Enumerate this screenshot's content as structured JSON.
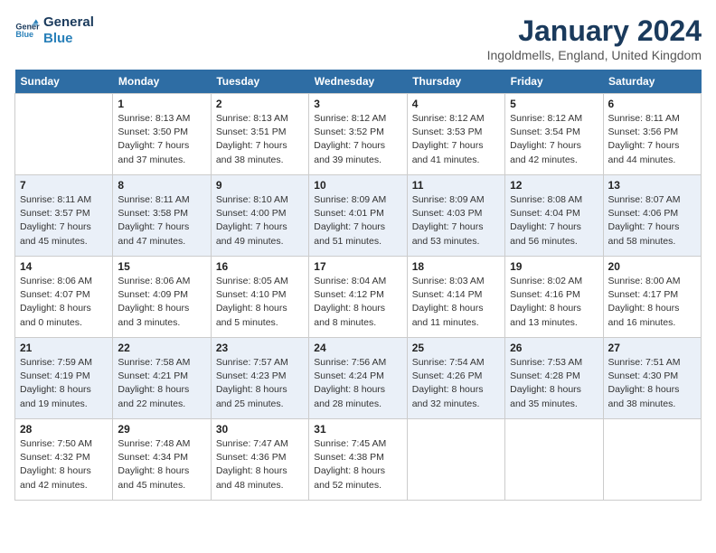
{
  "header": {
    "logo_line1": "General",
    "logo_line2": "Blue",
    "month_title": "January 2024",
    "location": "Ingoldmells, England, United Kingdom"
  },
  "days_of_week": [
    "Sunday",
    "Monday",
    "Tuesday",
    "Wednesday",
    "Thursday",
    "Friday",
    "Saturday"
  ],
  "weeks": [
    [
      {
        "day": "",
        "sunrise": "",
        "sunset": "",
        "daylight": ""
      },
      {
        "day": "1",
        "sunrise": "Sunrise: 8:13 AM",
        "sunset": "Sunset: 3:50 PM",
        "daylight": "Daylight: 7 hours and 37 minutes."
      },
      {
        "day": "2",
        "sunrise": "Sunrise: 8:13 AM",
        "sunset": "Sunset: 3:51 PM",
        "daylight": "Daylight: 7 hours and 38 minutes."
      },
      {
        "day": "3",
        "sunrise": "Sunrise: 8:12 AM",
        "sunset": "Sunset: 3:52 PM",
        "daylight": "Daylight: 7 hours and 39 minutes."
      },
      {
        "day": "4",
        "sunrise": "Sunrise: 8:12 AM",
        "sunset": "Sunset: 3:53 PM",
        "daylight": "Daylight: 7 hours and 41 minutes."
      },
      {
        "day": "5",
        "sunrise": "Sunrise: 8:12 AM",
        "sunset": "Sunset: 3:54 PM",
        "daylight": "Daylight: 7 hours and 42 minutes."
      },
      {
        "day": "6",
        "sunrise": "Sunrise: 8:11 AM",
        "sunset": "Sunset: 3:56 PM",
        "daylight": "Daylight: 7 hours and 44 minutes."
      }
    ],
    [
      {
        "day": "7",
        "sunrise": "Sunrise: 8:11 AM",
        "sunset": "Sunset: 3:57 PM",
        "daylight": "Daylight: 7 hours and 45 minutes."
      },
      {
        "day": "8",
        "sunrise": "Sunrise: 8:11 AM",
        "sunset": "Sunset: 3:58 PM",
        "daylight": "Daylight: 7 hours and 47 minutes."
      },
      {
        "day": "9",
        "sunrise": "Sunrise: 8:10 AM",
        "sunset": "Sunset: 4:00 PM",
        "daylight": "Daylight: 7 hours and 49 minutes."
      },
      {
        "day": "10",
        "sunrise": "Sunrise: 8:09 AM",
        "sunset": "Sunset: 4:01 PM",
        "daylight": "Daylight: 7 hours and 51 minutes."
      },
      {
        "day": "11",
        "sunrise": "Sunrise: 8:09 AM",
        "sunset": "Sunset: 4:03 PM",
        "daylight": "Daylight: 7 hours and 53 minutes."
      },
      {
        "day": "12",
        "sunrise": "Sunrise: 8:08 AM",
        "sunset": "Sunset: 4:04 PM",
        "daylight": "Daylight: 7 hours and 56 minutes."
      },
      {
        "day": "13",
        "sunrise": "Sunrise: 8:07 AM",
        "sunset": "Sunset: 4:06 PM",
        "daylight": "Daylight: 7 hours and 58 minutes."
      }
    ],
    [
      {
        "day": "14",
        "sunrise": "Sunrise: 8:06 AM",
        "sunset": "Sunset: 4:07 PM",
        "daylight": "Daylight: 8 hours and 0 minutes."
      },
      {
        "day": "15",
        "sunrise": "Sunrise: 8:06 AM",
        "sunset": "Sunset: 4:09 PM",
        "daylight": "Daylight: 8 hours and 3 minutes."
      },
      {
        "day": "16",
        "sunrise": "Sunrise: 8:05 AM",
        "sunset": "Sunset: 4:10 PM",
        "daylight": "Daylight: 8 hours and 5 minutes."
      },
      {
        "day": "17",
        "sunrise": "Sunrise: 8:04 AM",
        "sunset": "Sunset: 4:12 PM",
        "daylight": "Daylight: 8 hours and 8 minutes."
      },
      {
        "day": "18",
        "sunrise": "Sunrise: 8:03 AM",
        "sunset": "Sunset: 4:14 PM",
        "daylight": "Daylight: 8 hours and 11 minutes."
      },
      {
        "day": "19",
        "sunrise": "Sunrise: 8:02 AM",
        "sunset": "Sunset: 4:16 PM",
        "daylight": "Daylight: 8 hours and 13 minutes."
      },
      {
        "day": "20",
        "sunrise": "Sunrise: 8:00 AM",
        "sunset": "Sunset: 4:17 PM",
        "daylight": "Daylight: 8 hours and 16 minutes."
      }
    ],
    [
      {
        "day": "21",
        "sunrise": "Sunrise: 7:59 AM",
        "sunset": "Sunset: 4:19 PM",
        "daylight": "Daylight: 8 hours and 19 minutes."
      },
      {
        "day": "22",
        "sunrise": "Sunrise: 7:58 AM",
        "sunset": "Sunset: 4:21 PM",
        "daylight": "Daylight: 8 hours and 22 minutes."
      },
      {
        "day": "23",
        "sunrise": "Sunrise: 7:57 AM",
        "sunset": "Sunset: 4:23 PM",
        "daylight": "Daylight: 8 hours and 25 minutes."
      },
      {
        "day": "24",
        "sunrise": "Sunrise: 7:56 AM",
        "sunset": "Sunset: 4:24 PM",
        "daylight": "Daylight: 8 hours and 28 minutes."
      },
      {
        "day": "25",
        "sunrise": "Sunrise: 7:54 AM",
        "sunset": "Sunset: 4:26 PM",
        "daylight": "Daylight: 8 hours and 32 minutes."
      },
      {
        "day": "26",
        "sunrise": "Sunrise: 7:53 AM",
        "sunset": "Sunset: 4:28 PM",
        "daylight": "Daylight: 8 hours and 35 minutes."
      },
      {
        "day": "27",
        "sunrise": "Sunrise: 7:51 AM",
        "sunset": "Sunset: 4:30 PM",
        "daylight": "Daylight: 8 hours and 38 minutes."
      }
    ],
    [
      {
        "day": "28",
        "sunrise": "Sunrise: 7:50 AM",
        "sunset": "Sunset: 4:32 PM",
        "daylight": "Daylight: 8 hours and 42 minutes."
      },
      {
        "day": "29",
        "sunrise": "Sunrise: 7:48 AM",
        "sunset": "Sunset: 4:34 PM",
        "daylight": "Daylight: 8 hours and 45 minutes."
      },
      {
        "day": "30",
        "sunrise": "Sunrise: 7:47 AM",
        "sunset": "Sunset: 4:36 PM",
        "daylight": "Daylight: 8 hours and 48 minutes."
      },
      {
        "day": "31",
        "sunrise": "Sunrise: 7:45 AM",
        "sunset": "Sunset: 4:38 PM",
        "daylight": "Daylight: 8 hours and 52 minutes."
      },
      {
        "day": "",
        "sunrise": "",
        "sunset": "",
        "daylight": ""
      },
      {
        "day": "",
        "sunrise": "",
        "sunset": "",
        "daylight": ""
      },
      {
        "day": "",
        "sunrise": "",
        "sunset": "",
        "daylight": ""
      }
    ]
  ]
}
